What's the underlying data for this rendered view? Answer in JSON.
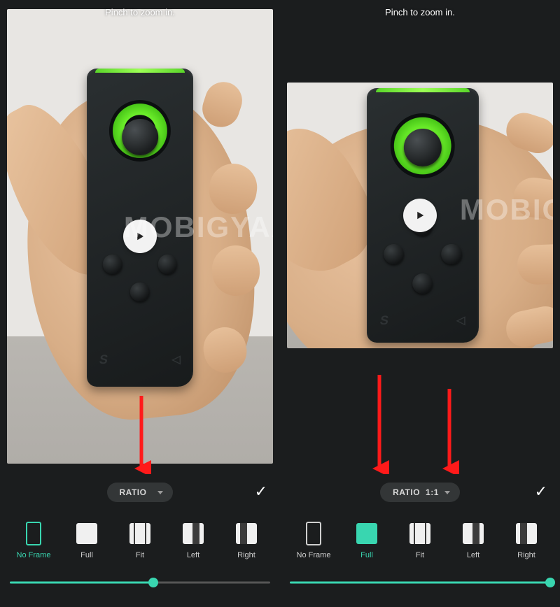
{
  "watermark": "MOBIGYAA",
  "panes": [
    {
      "hint": "Pinch to zoom in.",
      "preview_mode": "noframe",
      "ratio_label": "RATIO",
      "ratio_value": "",
      "confirm_glyph": "✓",
      "frame_options": [
        {
          "id": "noframe",
          "label": "No Frame",
          "selected": true
        },
        {
          "id": "full",
          "label": "Full",
          "selected": false
        },
        {
          "id": "fit",
          "label": "Fit",
          "selected": false
        },
        {
          "id": "left",
          "label": "Left",
          "selected": false
        },
        {
          "id": "right",
          "label": "Right",
          "selected": false
        }
      ],
      "slider_percent": 55
    },
    {
      "hint": "Pinch to zoom in.",
      "preview_mode": "full_1_1",
      "ratio_label": "RATIO",
      "ratio_value": "1:1",
      "confirm_glyph": "✓",
      "frame_options": [
        {
          "id": "noframe",
          "label": "No Frame",
          "selected": false
        },
        {
          "id": "full",
          "label": "Full",
          "selected": true
        },
        {
          "id": "fit",
          "label": "Fit",
          "selected": false
        },
        {
          "id": "left",
          "label": "Left",
          "selected": false
        },
        {
          "id": "right",
          "label": "Right",
          "selected": false
        }
      ],
      "slider_percent": 100
    }
  ],
  "colors": {
    "accent": "#39d6b0",
    "bg": "#1b1d1e",
    "arrow": "#ff1a1a"
  }
}
